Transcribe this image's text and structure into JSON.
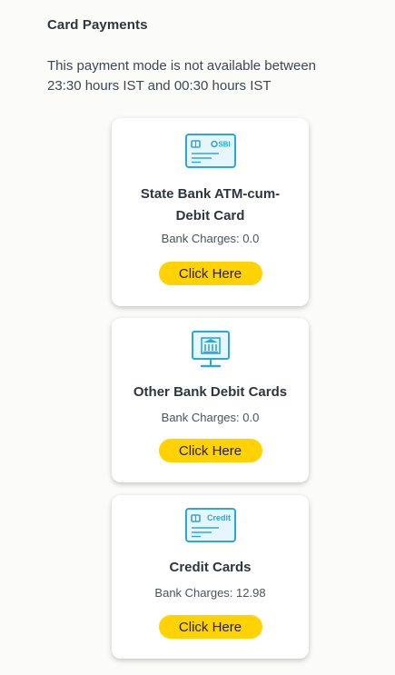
{
  "section": {
    "title": "Card Payments",
    "notice": "This payment mode is not available between 23:30 hours IST and 00:30 hours IST"
  },
  "colors": {
    "button": "#ffd200",
    "icon_stroke": "#2aa8d6",
    "icon_fill": "#e6f6fc"
  },
  "cards": [
    {
      "icon": "debit-card-icon",
      "icon_text": "SBI",
      "title_lines": [
        "State Bank ATM-cum-",
        "Debit Card"
      ],
      "charges": "Bank Charges: 0.0",
      "button_label": "Click Here"
    },
    {
      "icon": "bank-monitor-icon",
      "title": "Other Bank Debit Cards",
      "charges": "Bank Charges: 0.0",
      "button_label": "Click Here"
    },
    {
      "icon": "credit-card-icon",
      "icon_text": "Credit",
      "title": "Credit Cards",
      "charges": "Bank Charges: 12.98",
      "button_label": "Click Here"
    }
  ]
}
